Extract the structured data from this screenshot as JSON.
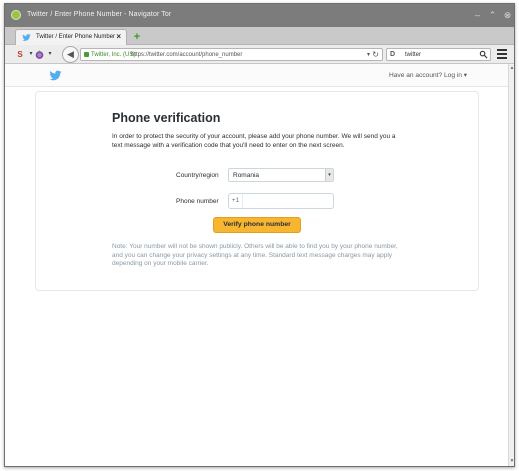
{
  "window": {
    "title": "Twitter / Enter Phone Number - Navigator Tor"
  },
  "tabs": [
    {
      "label": "Twitter / Enter Phone Number",
      "close": "×"
    }
  ],
  "newtab": {
    "label": "+"
  },
  "nav": {
    "identity": "Twitter, Inc. (US)",
    "url": "https://twitter.com/account/phone_number",
    "search_engine": "D",
    "search_query": "twitter",
    "reload": "↻"
  },
  "page": {
    "login_text": "Have an account? Log in ▾",
    "title": "Phone verification",
    "lead": "In order to protect the security of your account, please add your phone number. We will send you a text message with a verification code that you'll need to enter on the next screen.",
    "country_label": "Country/region",
    "country_value": "Romania",
    "phone_label": "Phone number",
    "phone_prefix": "+1",
    "phone_value": "",
    "verify_button": "Verify phone number",
    "note": "Note: Your number will not be shown publicly. Others will be able to find you by your phone number, and you can change your privacy settings at any time. Standard text message charges may apply depending on your mobile carrier."
  },
  "colors": {
    "twitter_blue": "#55acee",
    "verify_button": "#f7b531",
    "titlebar": "#7c7c7c"
  },
  "icons": [
    "twitter-bird-icon",
    "tor-onion-icon",
    "back-arrow-icon",
    "lock-icon",
    "search-icon",
    "menu-icon"
  ]
}
